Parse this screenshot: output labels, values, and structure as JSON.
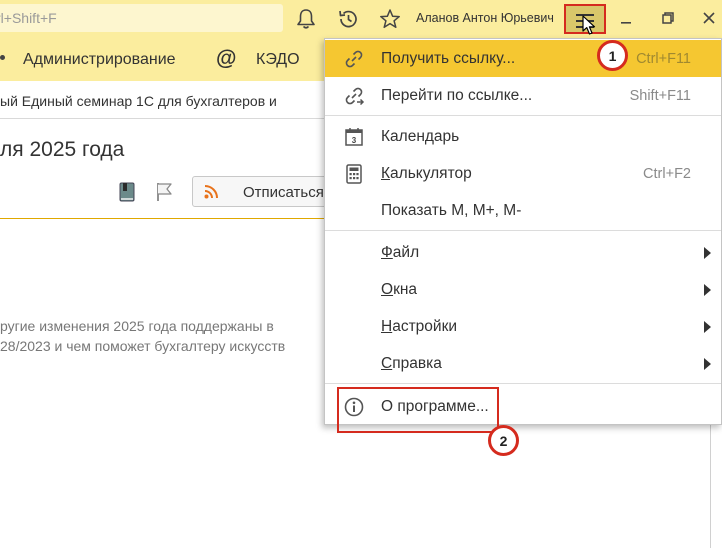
{
  "titlebar": {
    "search_text": "rl+Shift+F",
    "user_name": "Аланов Антон Юрьевич",
    "icons": [
      "bell-icon",
      "history-icon",
      "star-icon",
      "hamburger-menu-icon",
      "minimize-icon",
      "restore-icon",
      "close-icon"
    ]
  },
  "sections": {
    "administration": "Администрирование",
    "kedo": "КЭДО"
  },
  "tab": {
    "label": "ый Единый семинар 1С для бухгалтеров и"
  },
  "document": {
    "title": "ля 2025 года",
    "unsubscribe": "Отписаться",
    "body_line1": "ругие изменения 2025 года поддержаны в",
    "body_line2": "28/2023 и чем поможет бухгалтеру искусств"
  },
  "menu": {
    "get_link": {
      "label": "Получить ссылку...",
      "shortcut": "Ctrl+F11"
    },
    "go_link": {
      "label": "Перейти по ссылке...",
      "shortcut": "Shift+F11"
    },
    "calendar": {
      "label": "Календарь"
    },
    "calculator": {
      "label": "Калькулятор",
      "shortcut": "Ctrl+F2"
    },
    "show_m": {
      "label": "Показать M, M+, M-"
    },
    "file": {
      "label": "Файл"
    },
    "windows": {
      "label": "Окна"
    },
    "settings": {
      "label": "Настройки"
    },
    "help": {
      "label": "Справка"
    },
    "about": {
      "label": "О программе..."
    }
  },
  "annotations": {
    "step1": "1",
    "step2": "2"
  },
  "colors": {
    "title_bar": "#fbed9e",
    "highlight": "#f5c731",
    "marker": "#d52b1e"
  }
}
